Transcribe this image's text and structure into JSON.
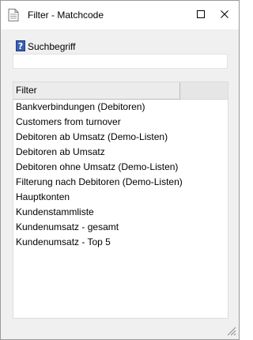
{
  "window": {
    "title": "Filter - Matchcode"
  },
  "search": {
    "label": "Suchbegriff",
    "value": "",
    "placeholder": ""
  },
  "grid": {
    "column_header": "Filter",
    "rows": [
      "Bankverbindungen (Debitoren)",
      "Customers from turnover",
      "Debitoren ab Umsatz (Demo-Listen)",
      "Debitoren ab Umsatz",
      "Debitoren ohne Umsatz (Demo-Listen)",
      "Filterung nach Debitoren (Demo-Listen)",
      "Hauptkonten",
      "Kundenstammliste",
      "Kundenumsatz - gesamt",
      "Kundenumsatz - Top 5"
    ]
  },
  "icons": {
    "app": "document-icon",
    "maximize": "maximize-icon",
    "close": "close-icon",
    "help": "help-icon",
    "resize": "resize-grip-icon"
  }
}
